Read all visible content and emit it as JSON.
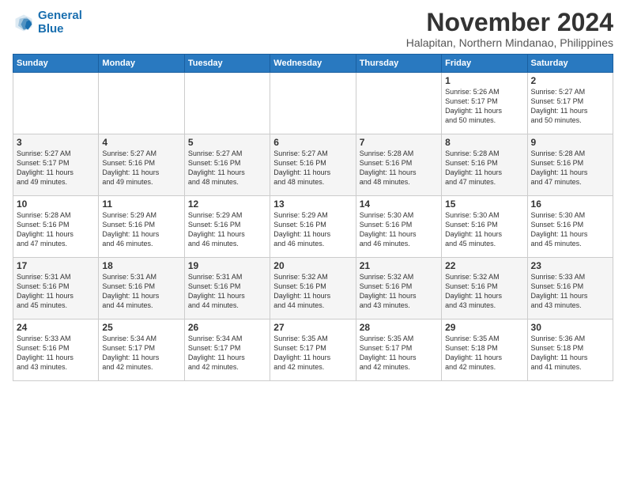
{
  "logo": {
    "line1": "General",
    "line2": "Blue"
  },
  "title": "November 2024",
  "location": "Halapitan, Northern Mindanao, Philippines",
  "weekdays": [
    "Sunday",
    "Monday",
    "Tuesday",
    "Wednesday",
    "Thursday",
    "Friday",
    "Saturday"
  ],
  "weeks": [
    [
      {
        "day": "",
        "info": ""
      },
      {
        "day": "",
        "info": ""
      },
      {
        "day": "",
        "info": ""
      },
      {
        "day": "",
        "info": ""
      },
      {
        "day": "",
        "info": ""
      },
      {
        "day": "1",
        "info": "Sunrise: 5:26 AM\nSunset: 5:17 PM\nDaylight: 11 hours\nand 50 minutes."
      },
      {
        "day": "2",
        "info": "Sunrise: 5:27 AM\nSunset: 5:17 PM\nDaylight: 11 hours\nand 50 minutes."
      }
    ],
    [
      {
        "day": "3",
        "info": "Sunrise: 5:27 AM\nSunset: 5:17 PM\nDaylight: 11 hours\nand 49 minutes."
      },
      {
        "day": "4",
        "info": "Sunrise: 5:27 AM\nSunset: 5:16 PM\nDaylight: 11 hours\nand 49 minutes."
      },
      {
        "day": "5",
        "info": "Sunrise: 5:27 AM\nSunset: 5:16 PM\nDaylight: 11 hours\nand 48 minutes."
      },
      {
        "day": "6",
        "info": "Sunrise: 5:27 AM\nSunset: 5:16 PM\nDaylight: 11 hours\nand 48 minutes."
      },
      {
        "day": "7",
        "info": "Sunrise: 5:28 AM\nSunset: 5:16 PM\nDaylight: 11 hours\nand 48 minutes."
      },
      {
        "day": "8",
        "info": "Sunrise: 5:28 AM\nSunset: 5:16 PM\nDaylight: 11 hours\nand 47 minutes."
      },
      {
        "day": "9",
        "info": "Sunrise: 5:28 AM\nSunset: 5:16 PM\nDaylight: 11 hours\nand 47 minutes."
      }
    ],
    [
      {
        "day": "10",
        "info": "Sunrise: 5:28 AM\nSunset: 5:16 PM\nDaylight: 11 hours\nand 47 minutes."
      },
      {
        "day": "11",
        "info": "Sunrise: 5:29 AM\nSunset: 5:16 PM\nDaylight: 11 hours\nand 46 minutes."
      },
      {
        "day": "12",
        "info": "Sunrise: 5:29 AM\nSunset: 5:16 PM\nDaylight: 11 hours\nand 46 minutes."
      },
      {
        "day": "13",
        "info": "Sunrise: 5:29 AM\nSunset: 5:16 PM\nDaylight: 11 hours\nand 46 minutes."
      },
      {
        "day": "14",
        "info": "Sunrise: 5:30 AM\nSunset: 5:16 PM\nDaylight: 11 hours\nand 46 minutes."
      },
      {
        "day": "15",
        "info": "Sunrise: 5:30 AM\nSunset: 5:16 PM\nDaylight: 11 hours\nand 45 minutes."
      },
      {
        "day": "16",
        "info": "Sunrise: 5:30 AM\nSunset: 5:16 PM\nDaylight: 11 hours\nand 45 minutes."
      }
    ],
    [
      {
        "day": "17",
        "info": "Sunrise: 5:31 AM\nSunset: 5:16 PM\nDaylight: 11 hours\nand 45 minutes."
      },
      {
        "day": "18",
        "info": "Sunrise: 5:31 AM\nSunset: 5:16 PM\nDaylight: 11 hours\nand 44 minutes."
      },
      {
        "day": "19",
        "info": "Sunrise: 5:31 AM\nSunset: 5:16 PM\nDaylight: 11 hours\nand 44 minutes."
      },
      {
        "day": "20",
        "info": "Sunrise: 5:32 AM\nSunset: 5:16 PM\nDaylight: 11 hours\nand 44 minutes."
      },
      {
        "day": "21",
        "info": "Sunrise: 5:32 AM\nSunset: 5:16 PM\nDaylight: 11 hours\nand 43 minutes."
      },
      {
        "day": "22",
        "info": "Sunrise: 5:32 AM\nSunset: 5:16 PM\nDaylight: 11 hours\nand 43 minutes."
      },
      {
        "day": "23",
        "info": "Sunrise: 5:33 AM\nSunset: 5:16 PM\nDaylight: 11 hours\nand 43 minutes."
      }
    ],
    [
      {
        "day": "24",
        "info": "Sunrise: 5:33 AM\nSunset: 5:16 PM\nDaylight: 11 hours\nand 43 minutes."
      },
      {
        "day": "25",
        "info": "Sunrise: 5:34 AM\nSunset: 5:17 PM\nDaylight: 11 hours\nand 42 minutes."
      },
      {
        "day": "26",
        "info": "Sunrise: 5:34 AM\nSunset: 5:17 PM\nDaylight: 11 hours\nand 42 minutes."
      },
      {
        "day": "27",
        "info": "Sunrise: 5:35 AM\nSunset: 5:17 PM\nDaylight: 11 hours\nand 42 minutes."
      },
      {
        "day": "28",
        "info": "Sunrise: 5:35 AM\nSunset: 5:17 PM\nDaylight: 11 hours\nand 42 minutes."
      },
      {
        "day": "29",
        "info": "Sunrise: 5:35 AM\nSunset: 5:18 PM\nDaylight: 11 hours\nand 42 minutes."
      },
      {
        "day": "30",
        "info": "Sunrise: 5:36 AM\nSunset: 5:18 PM\nDaylight: 11 hours\nand 41 minutes."
      }
    ]
  ]
}
